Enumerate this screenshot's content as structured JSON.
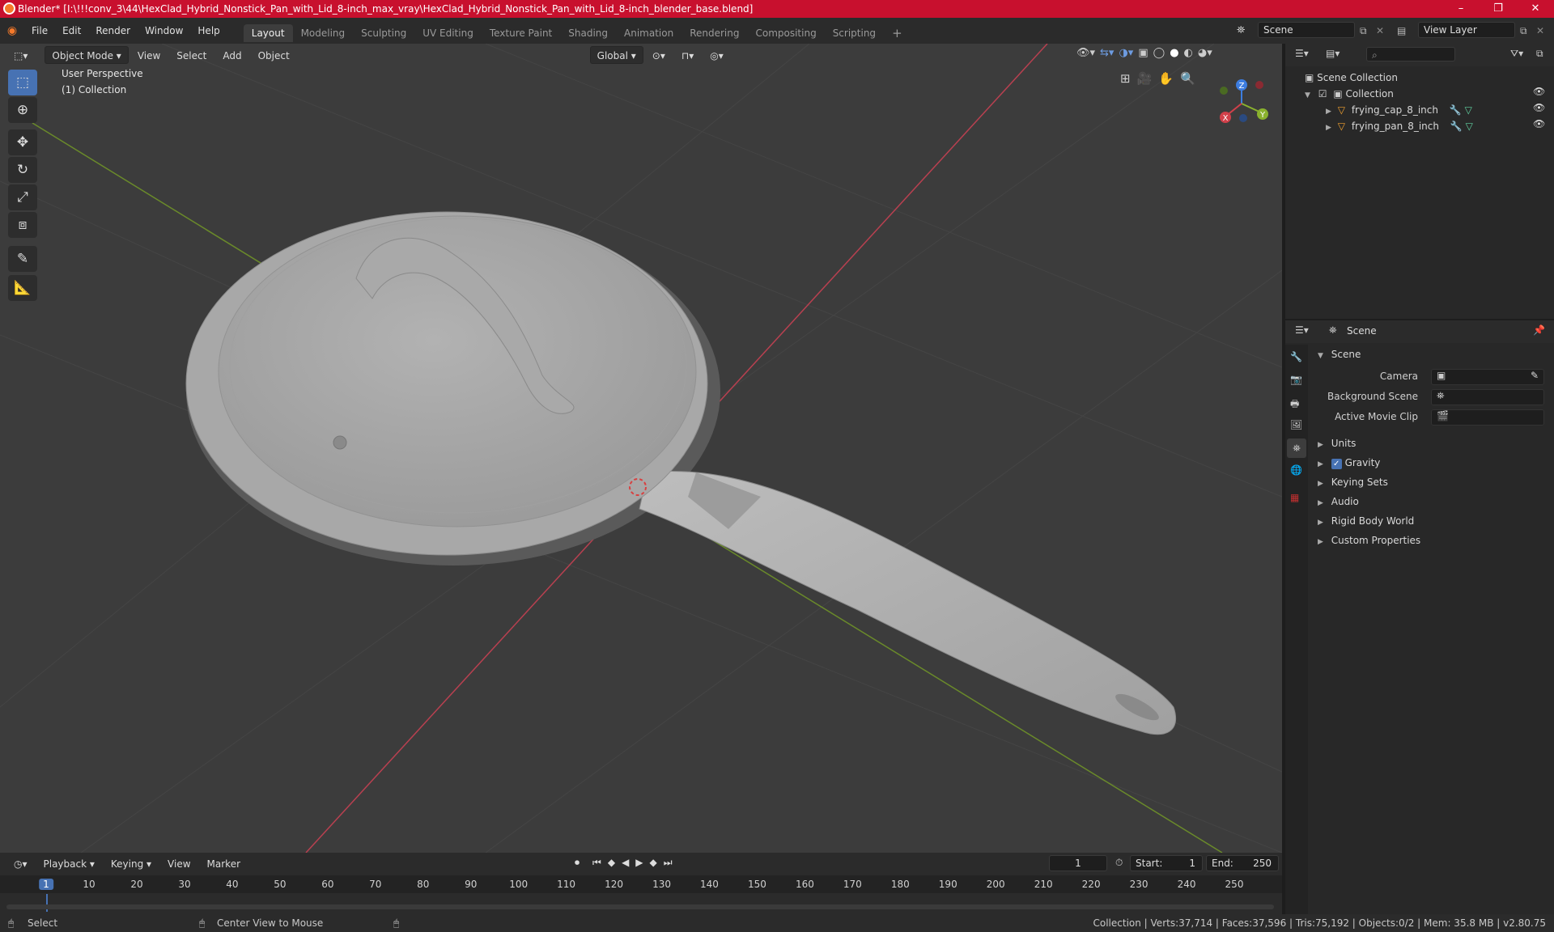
{
  "window": {
    "title": "Blender* [I:\\!!!conv_3\\44\\HexClad_Hybrid_Nonstick_Pan_with_Lid_8-inch_max_vray\\HexClad_Hybrid_Nonstick_Pan_with_Lid_8-inch_blender_base.blend]",
    "controls": [
      "–",
      "❐",
      "✕"
    ]
  },
  "menubar": {
    "menus": [
      "File",
      "Edit",
      "Render",
      "Window",
      "Help"
    ],
    "workspaces": [
      "Layout",
      "Modeling",
      "Sculpting",
      "UV Editing",
      "Texture Paint",
      "Shading",
      "Animation",
      "Rendering",
      "Compositing",
      "Scripting"
    ],
    "active_workspace": "Layout",
    "add_tab": "+",
    "scene_name": "Scene",
    "view_layer": "View Layer"
  },
  "viewport": {
    "mode": "Object Mode",
    "menus": [
      "View",
      "Select",
      "Add",
      "Object"
    ],
    "orientation": "Global",
    "overlay_line1": "User Perspective",
    "overlay_line2": "(1) Collection",
    "gizmo": {
      "x": "X",
      "y": "Y",
      "z": "Z"
    }
  },
  "outliner": {
    "root": "Scene Collection",
    "collection": "Collection",
    "objects": [
      "frying_cap_8_inch",
      "frying_pan_8_inch"
    ]
  },
  "properties": {
    "context": "Scene",
    "panel_title": "Scene",
    "fields": [
      {
        "label": "Camera",
        "value": ""
      },
      {
        "label": "Background Scene",
        "value": ""
      },
      {
        "label": "Active Movie Clip",
        "value": ""
      }
    ],
    "sections": [
      "Units",
      "Gravity",
      "Keying Sets",
      "Audio",
      "Rigid Body World",
      "Custom Properties"
    ],
    "gravity_checked": true
  },
  "timeline": {
    "menus": [
      "Playback",
      "Keying",
      "View",
      "Marker"
    ],
    "current_frame": "1",
    "start_label": "Start:",
    "start": "1",
    "end_label": "End:",
    "end": "250",
    "ticks": [
      "1",
      "10",
      "20",
      "30",
      "40",
      "50",
      "60",
      "70",
      "80",
      "90",
      "100",
      "110",
      "120",
      "130",
      "140",
      "150",
      "160",
      "170",
      "180",
      "190",
      "200",
      "210",
      "220",
      "230",
      "240",
      "250"
    ]
  },
  "statusbar": {
    "left_action": "Select",
    "middle_action": "Center View to Mouse",
    "stats": "Collection | Verts:37,714 | Faces:37,596 | Tris:75,192 | Objects:0/2 | Mem: 35.8 MB | v2.80.75"
  },
  "colors": {
    "titlebar": "#c8102e",
    "accent": "#4772b3",
    "x_axis": "#d0404a",
    "y_axis": "#8ab22e",
    "z_axis": "#3d7de0"
  }
}
